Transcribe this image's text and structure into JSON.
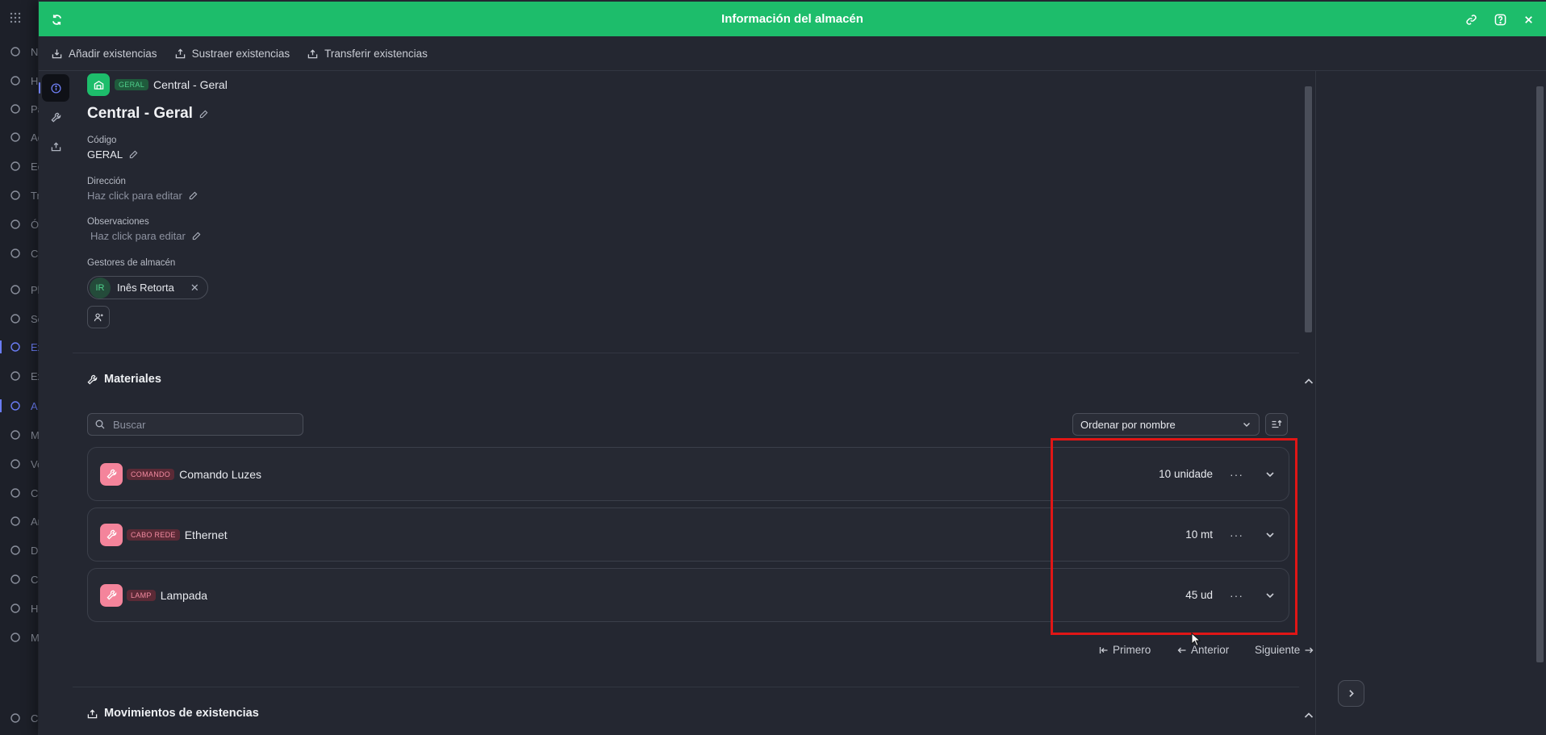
{
  "app": {
    "sidebar_items": [
      {
        "icon": "globe-icon",
        "label": "Ne"
      },
      {
        "icon": "help-circle-icon",
        "label": "He"
      },
      {
        "icon": "grid-icon",
        "label": "Pa"
      },
      {
        "icon": "activity-icon",
        "label": "Ac"
      },
      {
        "icon": "building-icon",
        "label": "Ec"
      },
      {
        "icon": "calendar-icon",
        "label": "Tr"
      },
      {
        "icon": "clipboard-icon",
        "label": "Ó"
      },
      {
        "icon": "calendar-icon",
        "label": "Ca"
      },
      {
        "icon": "calendar-icon",
        "label": "Pl"
      },
      {
        "icon": "bell-icon",
        "label": "Sc"
      },
      {
        "icon": "transfer-icon",
        "label": "Ex"
      },
      {
        "icon": "transfer-icon",
        "label": "Ex"
      },
      {
        "icon": "warehouse-icon",
        "label": "A"
      },
      {
        "icon": "wrench-icon",
        "label": "M"
      },
      {
        "icon": "tag-icon",
        "label": "Ve"
      },
      {
        "icon": "cart-icon",
        "label": "Co"
      },
      {
        "icon": "chart-icon",
        "label": "An"
      },
      {
        "icon": "document-icon",
        "label": "Do"
      },
      {
        "icon": "bolt-icon",
        "label": "Co"
      },
      {
        "icon": "home-icon",
        "label": "He"
      },
      {
        "icon": "pin-icon",
        "label": "M"
      },
      {
        "icon": "gear-icon",
        "label": "Co"
      }
    ]
  },
  "drawer": {
    "title": "Información del almacén",
    "accent_color": "#1dbd6b",
    "actions": [
      {
        "label": "Añadir existencias",
        "icon": "stock-in-icon"
      },
      {
        "label": "Sustraer existencias",
        "icon": "stock-out-icon"
      },
      {
        "label": "Transferir existencias",
        "icon": "transfer-icon"
      }
    ]
  },
  "warehouse": {
    "tag": "GERAL",
    "header_name": "Central - Geral",
    "title": "Central - Geral",
    "code_label": "Código",
    "code_value": "GERAL",
    "address_label": "Dirección",
    "address_placeholder": "Haz click para editar",
    "notes_label": "Observaciones",
    "notes_placeholder": "Haz click para editar",
    "managers_label": "Gestores de almacén",
    "managers": [
      {
        "initials": "IR",
        "name": "Inês Retorta"
      }
    ]
  },
  "materials": {
    "title": "Materiales",
    "search_placeholder": "Buscar",
    "sort_label": "Ordenar por nombre",
    "items": [
      {
        "tag": "COMANDO",
        "name": "Comando Luzes",
        "quantity": "10 unidade"
      },
      {
        "tag": "CABO REDE",
        "name": "Ethernet",
        "quantity": "10 mt"
      },
      {
        "tag": "LAMP",
        "name": "Lampada",
        "quantity": "45 ud"
      }
    ],
    "pagination": {
      "first": "Primero",
      "previous": "Anterior",
      "next": "Siguiente"
    }
  },
  "movements": {
    "title": "Movimientos de existencias"
  }
}
